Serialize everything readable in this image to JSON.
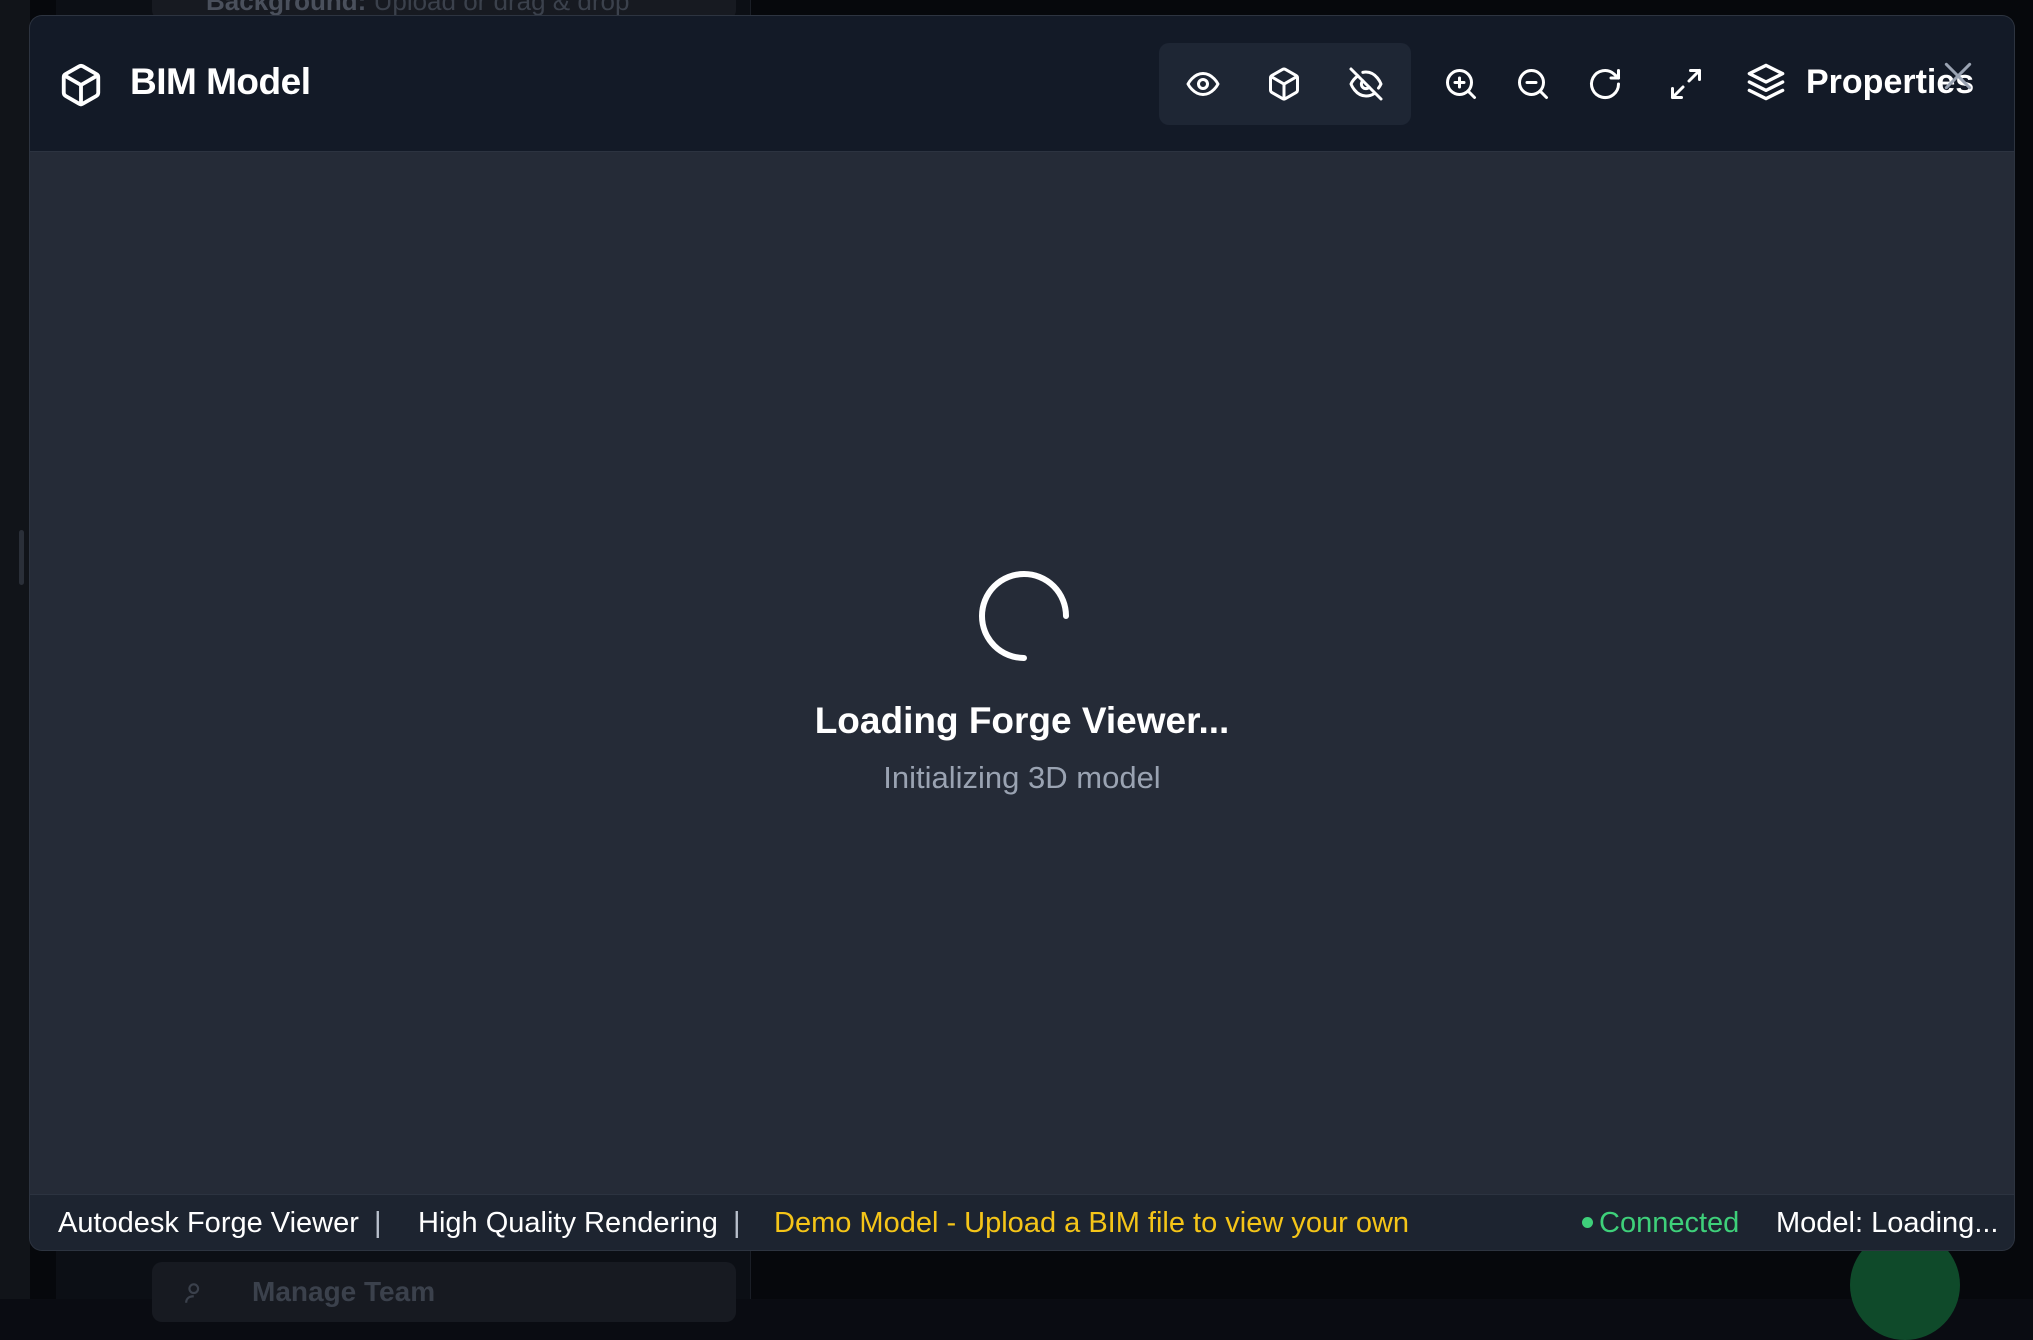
{
  "background": {
    "top_card": {
      "label": "Background:",
      "text": "Upload or drag & drop"
    },
    "bottom_card": {
      "label": "Manage Team"
    }
  },
  "modal": {
    "title": "BIM Model",
    "toolbar": {
      "view_group": [
        {
          "icon": "eye-icon"
        },
        {
          "icon": "cube-icon"
        },
        {
          "icon": "eye-off-icon"
        }
      ],
      "tools": [
        {
          "icon": "zoom-in-icon"
        },
        {
          "icon": "zoom-out-icon"
        },
        {
          "icon": "refresh-icon"
        },
        {
          "icon": "expand-icon"
        }
      ],
      "properties_label": "Properties",
      "properties_icon": "layers-icon",
      "close_icon": "close-icon"
    },
    "loading": {
      "title": "Loading Forge Viewer...",
      "subtitle": "Initializing 3D model"
    },
    "status_bar": {
      "viewer_name": "Autodesk Forge Viewer",
      "separator": "|",
      "quality": "High Quality Rendering",
      "demo_notice": "Demo Model - Upload a BIM file to view your own",
      "connection": "Connected",
      "model_status": "Model: Loading..."
    }
  },
  "colors": {
    "header_bg": "#131a27",
    "viewer_bg": "#252b37",
    "demo_text": "#f5c518",
    "connected": "#3ed07a",
    "muted_text": "#9aa3b2"
  }
}
